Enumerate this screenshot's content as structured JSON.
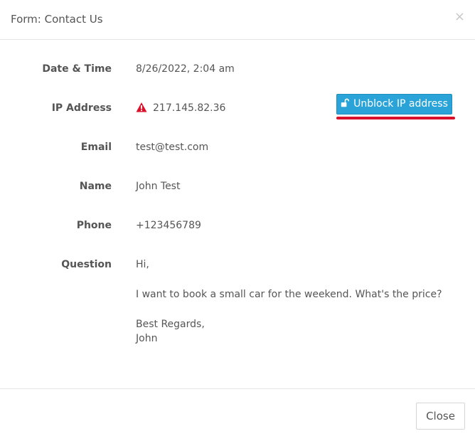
{
  "modal": {
    "title": "Form: Contact Us",
    "close_icon": "×"
  },
  "fields": {
    "datetime": {
      "label": "Date & Time",
      "value": "8/26/2022, 2:04 am"
    },
    "ip": {
      "label": "IP Address",
      "value": "217.145.82.36",
      "warning_icon": "warning-triangle-icon",
      "unblock_button_label": "Unblock IP address",
      "unblock_icon": "unlock-icon"
    },
    "email": {
      "label": "Email",
      "value": "test@test.com"
    },
    "name": {
      "label": "Name",
      "value": "John Test"
    },
    "phone": {
      "label": "Phone",
      "value": "+123456789"
    },
    "question": {
      "label": "Question",
      "lines": [
        "Hi,",
        "I want to book a small car for the weekend. What's the price?",
        "Best Regards,",
        "John"
      ]
    }
  },
  "footer": {
    "close_label": "Close"
  },
  "colors": {
    "button_primary": "#2aa3d8",
    "warning": "#d9112a",
    "highlight_underline": "#d9112a"
  }
}
